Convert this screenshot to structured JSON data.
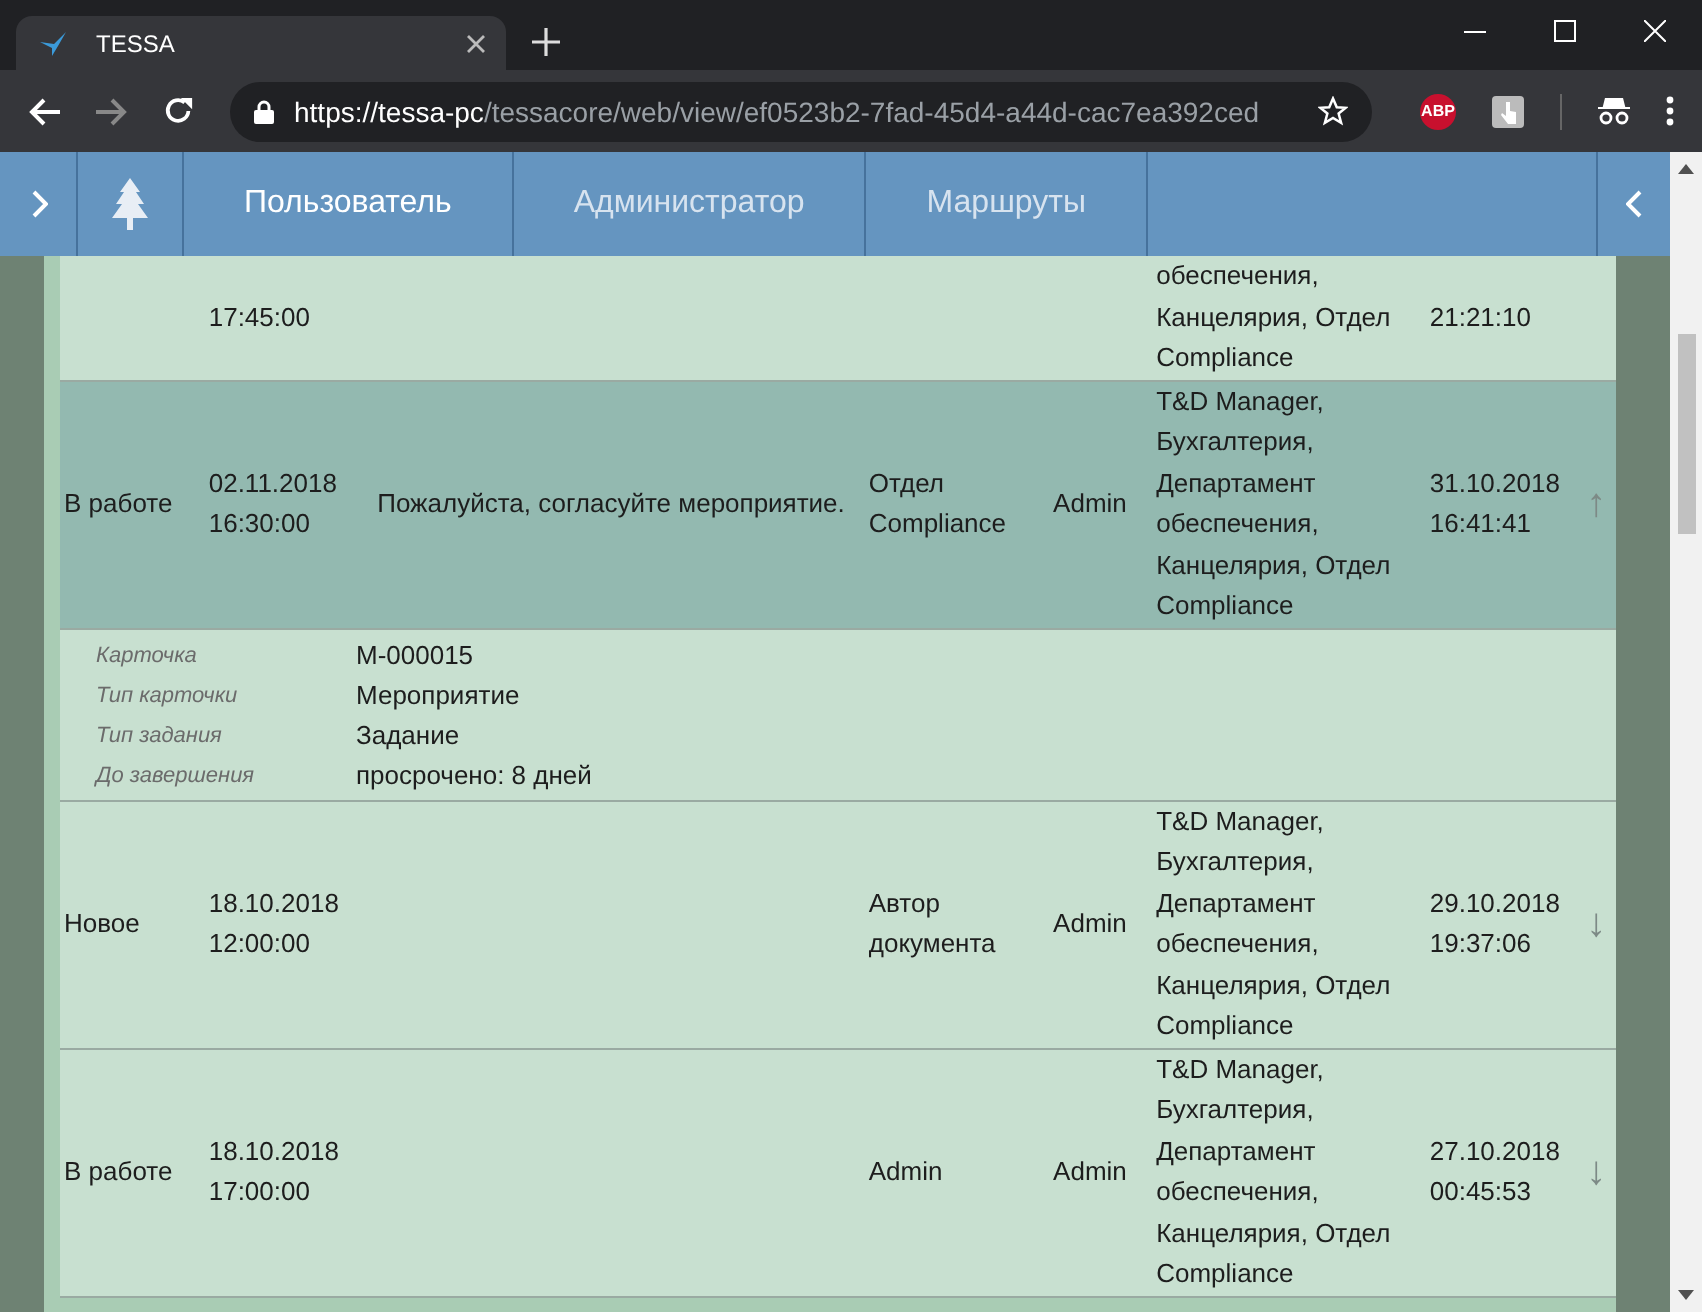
{
  "browser": {
    "tab_title": "TESSA",
    "url_host": "https://tessa-pc",
    "url_path": "/tessacore/web/view/ef0523b2-7fad-45d4-a44d-cac7ea392ced",
    "abp_label": "ABP"
  },
  "nav": {
    "tabs": [
      {
        "label": "Пользователь",
        "selected": true
      },
      {
        "label": "Администратор",
        "selected": false
      },
      {
        "label": "Маршруты",
        "selected": false
      }
    ]
  },
  "rows": [
    {
      "date": [
        "17:45:00"
      ],
      "departments": "обеспечения, Канцелярия, Отдел Compliance",
      "created": [
        "21:21:10"
      ],
      "selected": false
    },
    {
      "state": "В работе",
      "date": [
        "02.11.2018",
        "16:30:00"
      ],
      "description": "Пожалуйста, согласуйте мероприятие.",
      "performer": "Отдел Compliance",
      "author": "Admin",
      "departments": "T&D Manager, Бухгалтерия, Департамент обеспечения, Канцелярия, Отдел Compliance",
      "created": [
        "31.10.2018",
        "16:41:41"
      ],
      "arrow": "↑",
      "selected": true,
      "details": [
        {
          "label": "Карточка",
          "value": "M-000015"
        },
        {
          "label": "Тип карточки",
          "value": "Мероприятие"
        },
        {
          "label": "Тип задания",
          "value": "Задание"
        },
        {
          "label": "До завершения",
          "value": "просрочено: 8 дней"
        }
      ]
    },
    {
      "state": "Новое",
      "date": [
        "18.10.2018",
        "12:00:00"
      ],
      "performer": "Автор документа",
      "author": "Admin",
      "departments": "T&D Manager, Бухгалтерия, Департамент обеспечения, Канцелярия, Отдел Compliance",
      "created": [
        "29.10.2018",
        "19:37:06"
      ],
      "arrow": "↓",
      "selected": false
    },
    {
      "state": "В работе",
      "date": [
        "18.10.2018",
        "17:00:00"
      ],
      "performer": "Admin",
      "author": "Admin",
      "departments": "T&D Manager, Бухгалтерия, Департамент обеспечения, Канцелярия, Отдел Compliance",
      "created": [
        "27.10.2018",
        "00:45:53"
      ],
      "arrow": "↓",
      "selected": false
    }
  ]
}
